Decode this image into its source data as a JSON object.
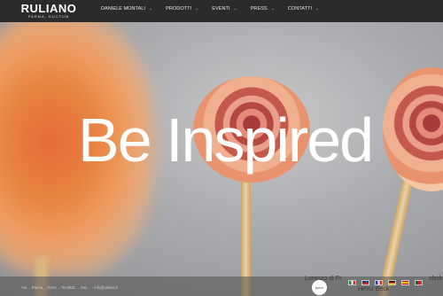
{
  "brand": {
    "name": "RULIANO",
    "tagline": "PARMA, DUCTUM"
  },
  "nav": {
    "items": [
      {
        "label": "DANIELE MONTALI"
      },
      {
        "label": "PRODOTTI"
      },
      {
        "label": "EVENTI"
      },
      {
        "label": "PRESS"
      },
      {
        "label": "CONTATTI"
      }
    ]
  },
  "hero": {
    "headline": "Be Inspired"
  },
  "footer": {
    "info": "Via ... Parma ... P.IVA ... Tel 0521 ... Fax ... - info@ruliano.it",
    "badge": "parco",
    "right_top": "Lorenzo di Pr",
    "right_top_tail": "sfedra",
    "right_bottom": "Heinz Beck",
    "languages": [
      "it",
      "en",
      "fr",
      "de",
      "es",
      "pt"
    ]
  },
  "colors": {
    "topbar": "#2b2b2b",
    "headline": "#ffffff"
  }
}
